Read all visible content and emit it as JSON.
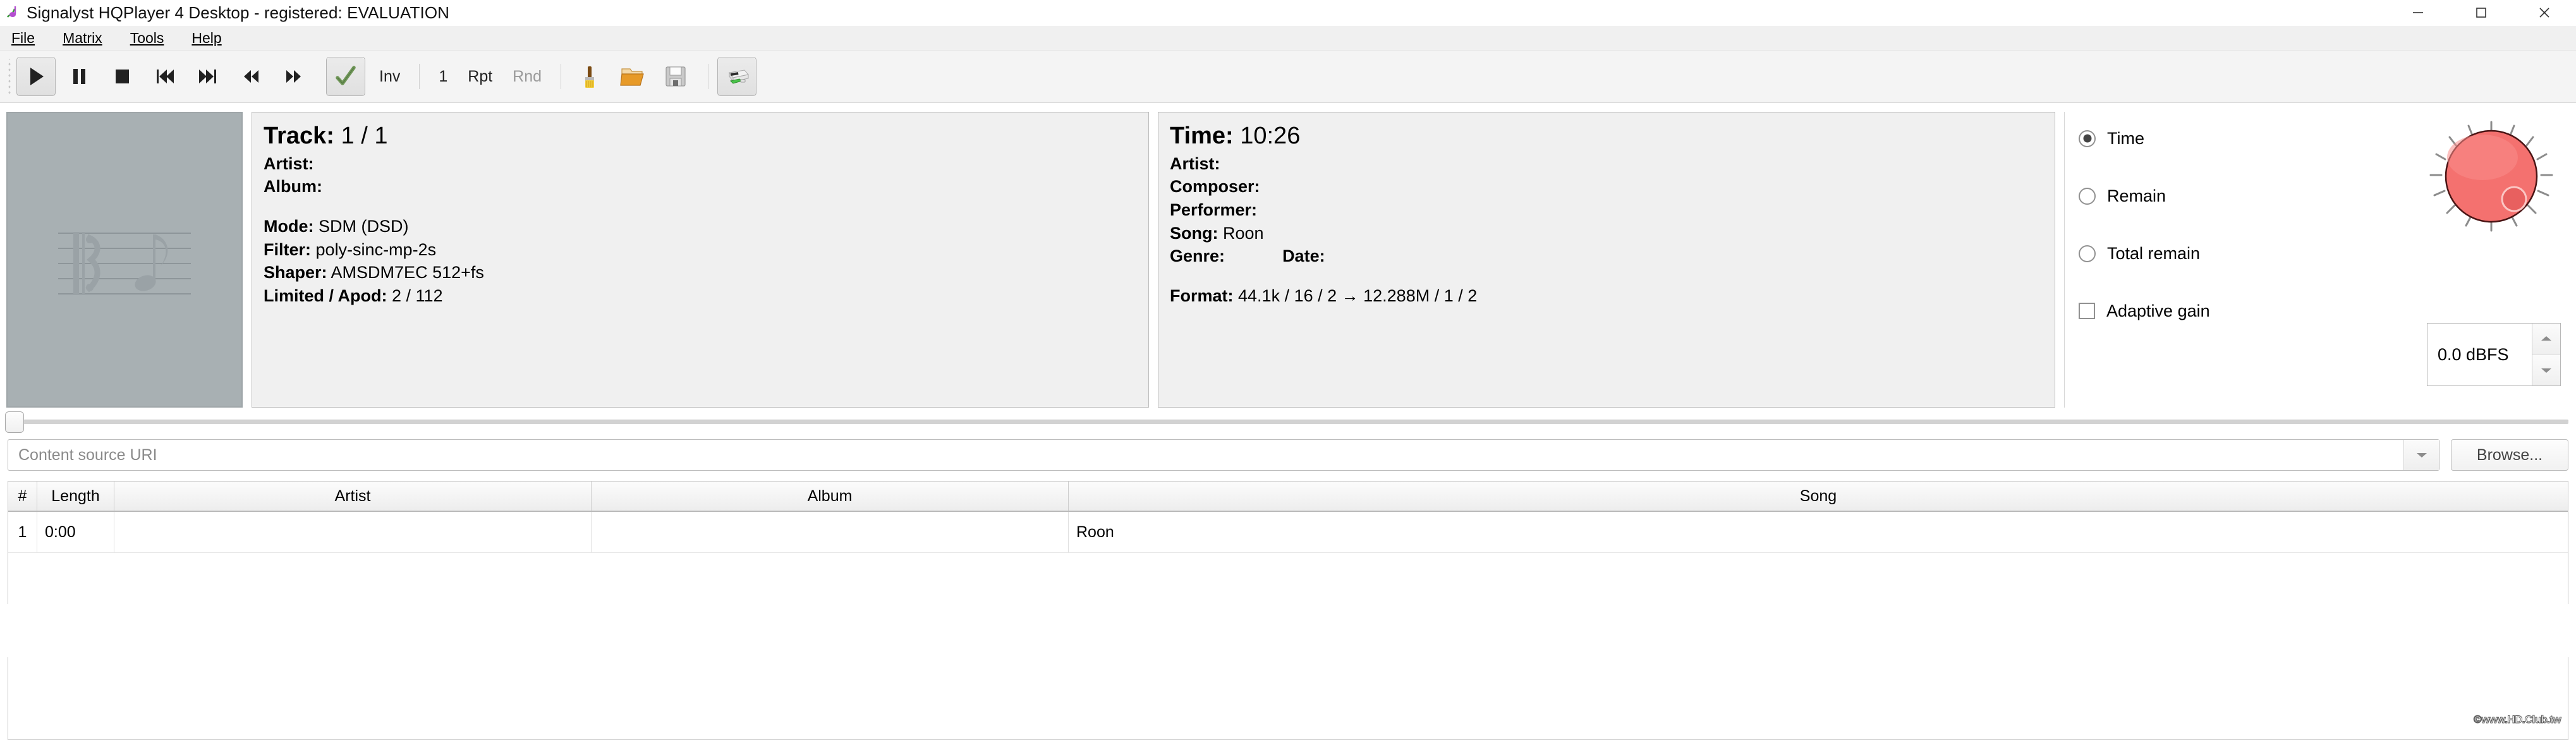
{
  "window": {
    "title": "Signalyst HQPlayer 4 Desktop - registered: EVALUATION",
    "app_icon": "music-note-icon",
    "controls": {
      "minimize": "minimize-icon",
      "maximize": "maximize-icon",
      "close": "close-icon"
    }
  },
  "menubar": {
    "items": [
      {
        "label": "File",
        "mnemonic": "F"
      },
      {
        "label": "Matrix",
        "mnemonic": "M"
      },
      {
        "label": "Tools",
        "mnemonic": "T"
      },
      {
        "label": "Help",
        "mnemonic": "H"
      }
    ]
  },
  "toolbar": {
    "play": "play-icon",
    "pause": "pause-icon",
    "stop": "stop-icon",
    "previous": "previous-track-icon",
    "next": "next-track-icon",
    "rewind": "rewind-icon",
    "forward": "fast-forward-icon",
    "check": "checkmark-icon",
    "invert_label": "Inv",
    "count_label": "1",
    "repeat_label": "Rpt",
    "random_label": "Rnd",
    "brush": "brush-icon",
    "open": "open-folder-icon",
    "save": "save-floppy-icon",
    "device": "audio-device-icon"
  },
  "album_art": {
    "placeholder_icon": "music-staff-note-icon"
  },
  "track_panel": {
    "heading_label": "Track:",
    "heading_value": "1 / 1",
    "artist_label": "Artist:",
    "artist_value": "",
    "album_label": "Album:",
    "album_value": "",
    "mode_label": "Mode:",
    "mode_value": "SDM (DSD)",
    "filter_label": "Filter:",
    "filter_value": "poly-sinc-mp-2s",
    "shaper_label": "Shaper:",
    "shaper_value": "AMSDM7EC 512+fs",
    "limited_label": "Limited / Apod:",
    "limited_value": "2 / 112"
  },
  "time_panel": {
    "heading_label": "Time:",
    "heading_value": "10:26",
    "artist_label": "Artist:",
    "artist_value": "",
    "composer_label": "Composer:",
    "composer_value": "",
    "performer_label": "Performer:",
    "performer_value": "",
    "song_label": "Song:",
    "song_value": "Roon",
    "genre_label": "Genre:",
    "genre_value": "",
    "date_label": "Date:",
    "date_value": "",
    "format_label": "Format:",
    "format_value": "44.1k / 16 / 2 → 12.288M / 1 / 2"
  },
  "display_options": {
    "time": {
      "label": "Time",
      "selected": true
    },
    "remain": {
      "label": "Remain",
      "selected": false
    },
    "total_remain": {
      "label": "Total remain",
      "selected": false
    },
    "adaptive_gain": {
      "label": "Adaptive gain",
      "checked": false
    }
  },
  "volume": {
    "knob_icon": "volume-knob",
    "knob_color": "#F4716F",
    "knob_border_color": "#4a1414",
    "value": "0.0 dBFS"
  },
  "seek": {
    "position_percent": 0
  },
  "source": {
    "placeholder": "Content source URI",
    "value": "",
    "dropdown_icon": "chevron-down-icon",
    "browse_label": "Browse..."
  },
  "playlist": {
    "columns": [
      {
        "key": "num",
        "label": "#"
      },
      {
        "key": "length",
        "label": "Length"
      },
      {
        "key": "artist",
        "label": "Artist"
      },
      {
        "key": "album",
        "label": "Album"
      },
      {
        "key": "song",
        "label": "Song"
      }
    ],
    "rows": [
      {
        "num": "1",
        "length": "0:00",
        "artist": "",
        "album": "",
        "song": "Roon"
      }
    ]
  },
  "watermark": {
    "text": "©www.HD.Club.tw"
  }
}
